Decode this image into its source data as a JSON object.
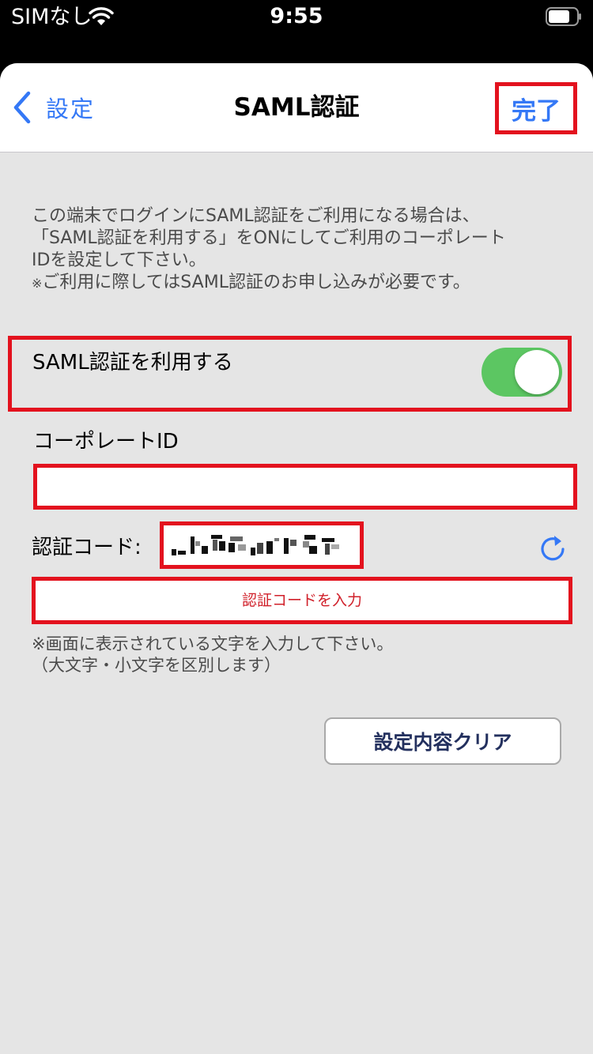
{
  "status_bar": {
    "carrier": "SIMなし",
    "time": "9:55",
    "wifi_icon": "wifi-icon",
    "battery_icon": "battery-icon"
  },
  "nav": {
    "back_label": "設定",
    "back_icon": "chevron-left-icon",
    "title": "SAML認証",
    "done_label": "完了"
  },
  "description": {
    "line1": "この端末でログインにSAML認証をご利用になる場合は、",
    "line2": "「SAML認証を利用する」をONにしてご利用のコーポレート",
    "line3": "IDを設定して下さい。",
    "note_mark": "※",
    "line4": "ご利用に際してはSAML認証のお申し込みが必要です。"
  },
  "saml_toggle": {
    "label": "SAML認証を利用する",
    "on": true
  },
  "corporate_id": {
    "label": "コーポレートID",
    "value": "",
    "placeholder": ""
  },
  "captcha": {
    "label": "認証コード:",
    "refresh_icon": "refresh-icon"
  },
  "code_input": {
    "placeholder": "認証コードを入力",
    "value": ""
  },
  "hint": {
    "line1": "※画面に表示されている文字を入力して下さい。",
    "line2": "（大文字・小文字を区別します）"
  },
  "clear_button": {
    "label": "設定内容クリア"
  },
  "colors": {
    "accent": "#3478f6",
    "highlight": "#e3121e",
    "toggle_on": "#5cc662",
    "background": "#e5e5e5",
    "button_text": "#23305e"
  }
}
